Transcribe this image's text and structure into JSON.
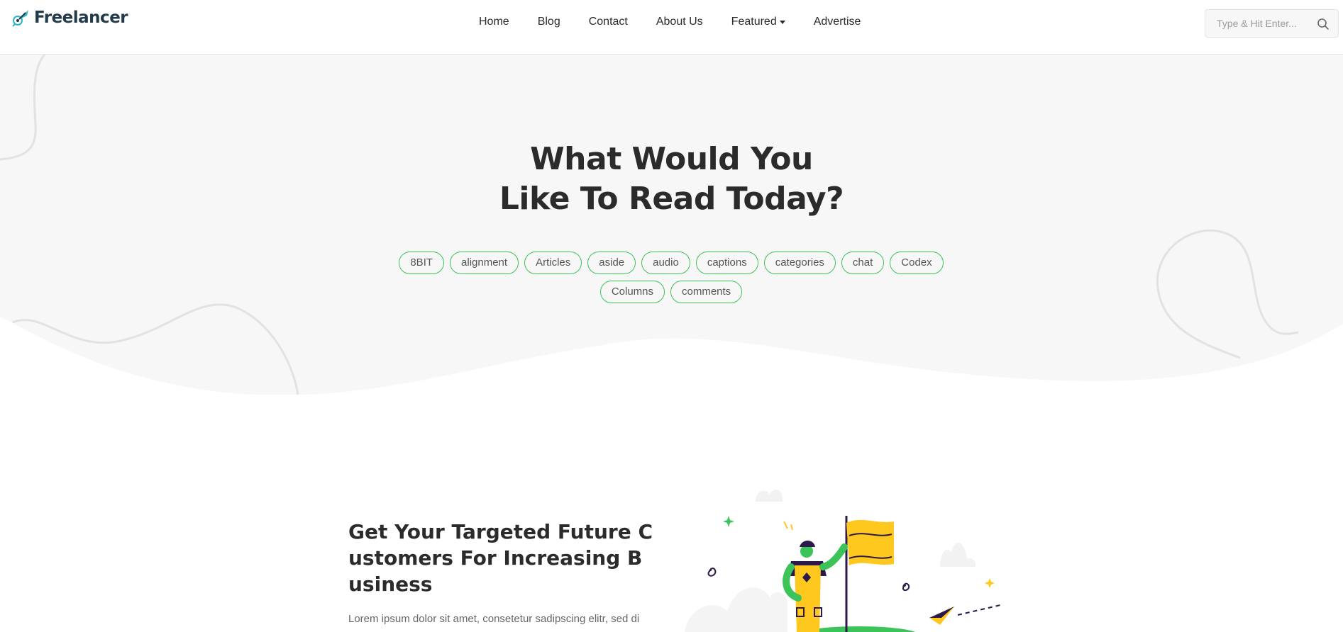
{
  "brand": {
    "name": "Freelancer",
    "logo_icon": "rocket-icon"
  },
  "nav": {
    "items": [
      {
        "label": "Home"
      },
      {
        "label": "Blog"
      },
      {
        "label": "Contact"
      },
      {
        "label": "About Us"
      },
      {
        "label": "Featured",
        "has_dropdown": true
      },
      {
        "label": "Advertise"
      }
    ]
  },
  "search": {
    "placeholder": "Type & Hit Enter...",
    "value": "",
    "icon": "search-icon"
  },
  "hero": {
    "title_line1": "What Would You",
    "title_line2": "Like To Read Today?",
    "tags": [
      "8BIT",
      "alignment",
      "Articles",
      "aside",
      "audio",
      "captions",
      "categories",
      "chat",
      "Codex",
      "Columns",
      "comments"
    ]
  },
  "feature": {
    "title": "Get Your Targeted Future Customers For Increasing Business",
    "body": "Lorem ipsum dolor sit amet, consetetur sadipscing elitr, sed di"
  },
  "colors": {
    "accent_green": "#3cc35a",
    "brand_teal": "#29b6c9",
    "flag_yellow": "#ffc81e",
    "hero_bg": "#f7f7f7",
    "text_dark": "#2b2b2b"
  }
}
